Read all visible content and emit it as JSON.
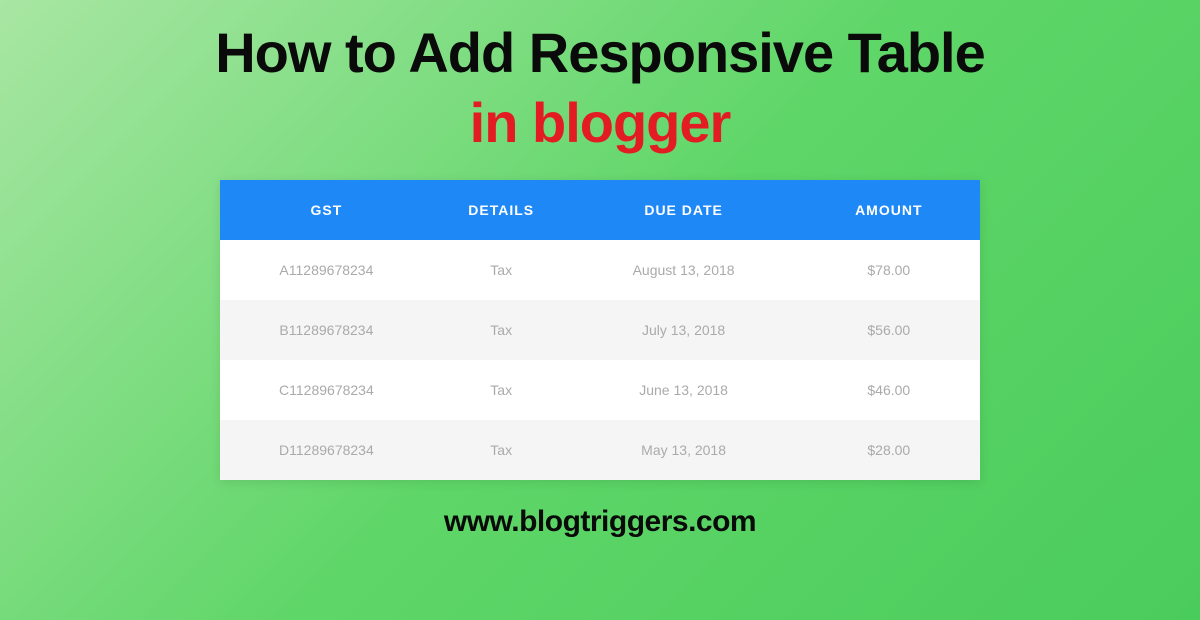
{
  "title": {
    "line1": "How to Add Responsive Table",
    "line2": "in blogger"
  },
  "table": {
    "headers": {
      "gst": "GST",
      "details": "DETAILS",
      "duedate": "DUE DATE",
      "amount": "AMOUNT"
    },
    "rows": [
      {
        "gst": "A11289678234",
        "details": "Tax",
        "duedate": "August 13, 2018",
        "amount": "$78.00"
      },
      {
        "gst": "B11289678234",
        "details": "Tax",
        "duedate": "July 13, 2018",
        "amount": "$56.00"
      },
      {
        "gst": "C11289678234",
        "details": "Tax",
        "duedate": "June 13, 2018",
        "amount": "$46.00"
      },
      {
        "gst": "D11289678234",
        "details": "Tax",
        "duedate": "May 13, 2018",
        "amount": "$28.00"
      }
    ]
  },
  "footer": {
    "url": "www.blogtriggers.com"
  },
  "colors": {
    "headerBlue": "#1e88f7",
    "titleRed": "#e31b23",
    "bgGreen": "#5fd668"
  }
}
